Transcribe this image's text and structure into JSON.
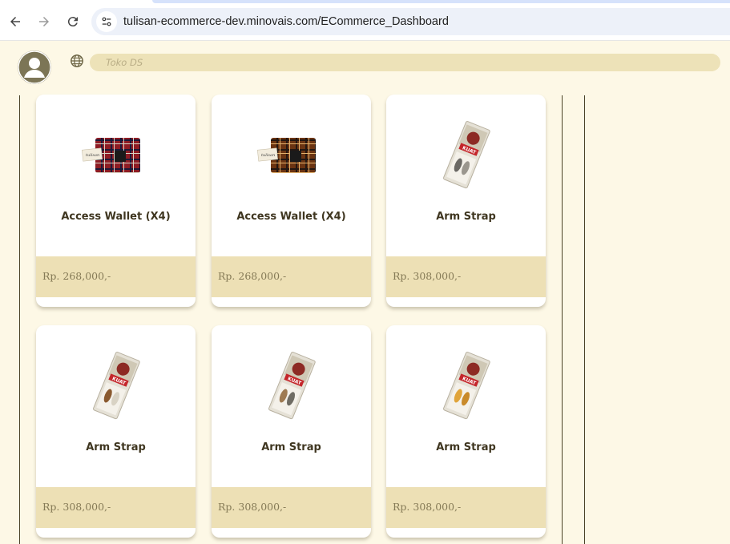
{
  "browser": {
    "url": "tulisan-ecommerce-dev.minovais.com/ECommerce_Dashboard"
  },
  "header": {
    "search_placeholder": "Toko DS"
  },
  "products": [
    {
      "name": "Access Wallet (X4)",
      "price": "Rp. 268,000,-",
      "image": "wallet-red-plaid"
    },
    {
      "name": "Access Wallet (X4)",
      "price": "Rp. 268,000,-",
      "image": "wallet-brown-plaid"
    },
    {
      "name": "Arm Strap",
      "price": "Rp. 308,000,-",
      "image": "arm-strap-box"
    },
    {
      "name": "Arm Strap",
      "price": "Rp. 308,000,-",
      "image": "arm-strap-box"
    },
    {
      "name": "Arm Strap",
      "price": "Rp. 308,000,-",
      "image": "arm-strap-box"
    },
    {
      "name": "Arm Strap",
      "price": "Rp. 308,000,-",
      "image": "arm-strap-box"
    }
  ],
  "colors": {
    "background": "#fdf8e6",
    "price_band": "#ede0b5",
    "search_bar": "#ede2b8",
    "avatar": "#7c7556",
    "product_title": "#3f3620"
  }
}
